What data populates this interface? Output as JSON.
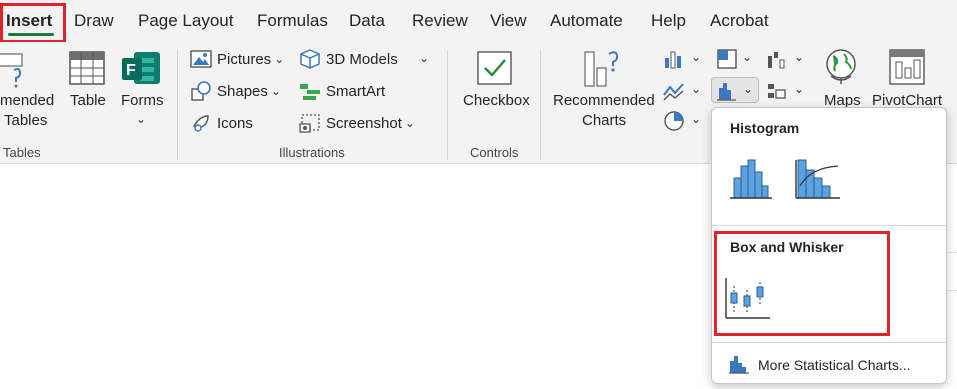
{
  "tabs": [
    "Insert",
    "Draw",
    "Page Layout",
    "Formulas",
    "Data",
    "Review",
    "View",
    "Automate",
    "Help",
    "Acrobat"
  ],
  "tables_group": {
    "recommended_label_line1": "mended",
    "recommended_label_line2": "Tables",
    "table_label": "Table",
    "forms_label": "Forms",
    "group_label": "Tables"
  },
  "illustrations": {
    "pictures": "Pictures",
    "shapes": "Shapes",
    "icons": "Icons",
    "models_3d": "3D Models",
    "smartart": "SmartArt",
    "screenshot": "Screenshot",
    "group_label": "Illustrations"
  },
  "controls": {
    "checkbox": "Checkbox",
    "group_label": "Controls"
  },
  "charts": {
    "recommended_line1": "Recommended",
    "recommended_line2": "Charts",
    "maps": "Maps",
    "pivotchart": "PivotChart"
  },
  "dropdown": {
    "histogram_header": "Histogram",
    "box_whisker_header": "Box and Whisker",
    "more_label": "More Statistical Charts..."
  },
  "colors": {
    "accent_green": "#1f7a3a",
    "highlight_red": "#e0232b",
    "chart_blue": "#5aa2e0"
  }
}
